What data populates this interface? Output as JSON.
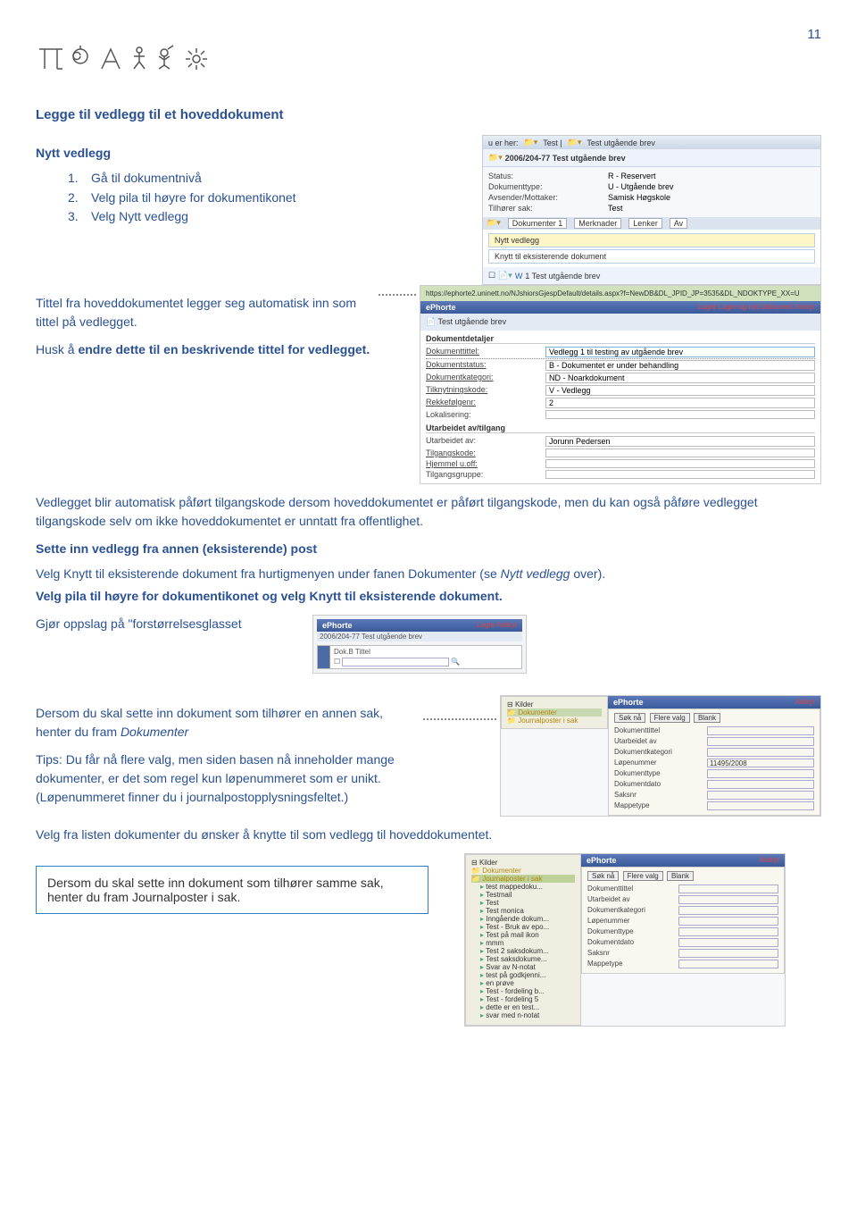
{
  "page_number": "11",
  "section_title": "Legge til vedlegg til et hoveddokument",
  "sub_nytt": "Nytt vedlegg",
  "steps": [
    {
      "n": "1.",
      "t": "Gå til dokumentnivå"
    },
    {
      "n": "2.",
      "t": "Velg pila til høyre for dokumentikonet"
    },
    {
      "n": "3.",
      "t": "Velg Nytt vedlegg"
    }
  ],
  "para_auto_title": "Tittel fra hoveddokumentet legger seg automatisk inn som tittel på vedlegget.",
  "para_husk": "Husk å endre dette til en beskrivende tittel for vedlegget.",
  "para_tilgangskode": "Vedlegget blir automatisk påført tilgangskode dersom hoveddokumentet er påført tilgangskode, men du kan også påføre vedlegget tilgangskode selv om ikke hoveddokumentet er unntatt fra offentlighet.",
  "sub_sette_inn": "Sette inn vedlegg fra annen (eksisterende) post",
  "para_knytt1": "Velg Knytt til eksisterende dokument fra hurtigmenyen under fanen Dokumenter (se ",
  "para_knytt1_em": "Nytt vedlegg",
  "para_knytt1_end": " over).",
  "para_knytt2": "Velg pila til høyre for dokumentikonet og velg Knytt til eksisterende dokument.",
  "para_gjor": "Gjør oppslag på \"forstørrelsesglasset",
  "para_dersom_annen": "Dersom du skal sette inn dokument som tilhører en annen sak, henter du fram ",
  "para_dersom_annen_em": "Dokumenter",
  "para_tips": "Tips: Du får nå flere valg, men siden basen nå inneholder mange dokumenter, er det som regel kun løpenummeret som er unikt. (Løpenummeret finner du i journalpostopplysningsfeltet.)",
  "para_velg_listen": "Velg fra listen dokumenter du ønsker å knytte til som vedlegg til hoveddokumentet.",
  "box_bottom": "Dersom du skal sette inn dokument som tilhører samme sak, henter du fram Journalposter i sak.",
  "fig1": {
    "breadcrumb_prefix": "u er her:",
    "breadcrumb_1": "Test |",
    "breadcrumb_2": "Test utgående brev",
    "doc_title_line": "2006/204-77  Test utgående brev",
    "rows": [
      {
        "lbl": "Status:",
        "val": "R - Reservert"
      },
      {
        "lbl": "Dokumenttype:",
        "val": "U - Utgående brev"
      },
      {
        "lbl": "Avsender/Mottaker:",
        "val": "Samisk Høgskole"
      },
      {
        "lbl": "Tilhører sak:",
        "val": "Test"
      }
    ],
    "tabs": [
      "Dokumenter   1",
      "Merknader",
      "Lenker",
      "Av"
    ],
    "menu1": "Nytt vedlegg",
    "menu2": "Knytt til eksisterende dokument",
    "row_after": "1       Test utgående brev"
  },
  "fig2": {
    "url": "https://ephorte2.uninett.no/NJshiorsGjespDefault/details.aspx?f=NewDB&DL_JPID_JP=3535&DL_NDOKTYPE_XX=U",
    "ephorte": "ePhorte",
    "menu_right": "Lagre   Lagre og nytt dokument   Avbryt",
    "tab": "Test utgående brev",
    "group_label": "Dokumentdetaljer",
    "title_label": "Dokumenttittel:",
    "title_value": "Vedlegg 1 til testing av utgående brev",
    "rows": [
      {
        "lbl": "Dokumentstatus:",
        "val": "B - Dokumentet er under behandling"
      },
      {
        "lbl": "Dokumentkategori:",
        "val": "ND - Noarkdokument"
      },
      {
        "lbl": "Tilknytningskode:",
        "val": "V - Vedlegg"
      },
      {
        "lbl": "Rekkefølgenr:",
        "val": "2"
      },
      {
        "lbl": "Lokalisering:",
        "val": ""
      }
    ],
    "group2": "Utarbeidet av/tilgang",
    "rows2": [
      {
        "lbl": "Utarbeidet av:",
        "val": "Jorunn Pedersen"
      },
      {
        "lbl": "Tilgangskode:",
        "val": ""
      },
      {
        "lbl": "Hjemmel u.off:",
        "val": ""
      },
      {
        "lbl": "Tilgangsgruppe:",
        "val": ""
      }
    ]
  },
  "fig3": {
    "ephorte": "ePhorte",
    "menu_right": "Lagre   Avbryt",
    "sub": "2006/204-77  Test utgående brev",
    "label": "Dok.B  Tittel"
  },
  "fig4": {
    "ephorte": "ePhorte",
    "avbryt": "Avbryt",
    "tree_header": "Kilder",
    "tree_items": [
      "Dokumenter",
      "Journalposter i sak"
    ],
    "btns": [
      "Søk nå",
      "Flere valg",
      "Blank"
    ],
    "fields": [
      "Dokumenttittel",
      "Utarbeidet av",
      "Dokumentkategori",
      "Løpenummer",
      "Dokumenttype",
      "Dokumentdato",
      "Saksnr",
      "Mappetype"
    ],
    "lnum_val": "11495/2008"
  },
  "fig5": {
    "ephorte": "ePhorte",
    "avbryt": "Avbryt",
    "tree_header": "Kilder",
    "tree_items_yellow": "Dokumenter",
    "tree_item_sel": "Journalposter i sak",
    "list_items": [
      "test mappedoku...",
      "Testmail",
      "Test",
      "Test monica",
      "Inngående dokum...",
      "Test - Bruk av epo...",
      "Test på mail ikon",
      "mmm",
      "Test 2 saksdokum...",
      "Test saksdokume...",
      "Svar av N-notat",
      "test på godkjenni...",
      "en prøve",
      "Test - fordeling b...",
      "Test - fordeling 5",
      "dette er en test...",
      "svar med n-notat"
    ],
    "btns": [
      "Søk nå",
      "Flere valg",
      "Blank"
    ],
    "fields": [
      "Dokumenttittel",
      "Utarbeidet av",
      "Dokumentkategori",
      "Løpenummer",
      "Dokumenttype",
      "Dokumentdato",
      "Saksnr",
      "Mappetype"
    ]
  }
}
